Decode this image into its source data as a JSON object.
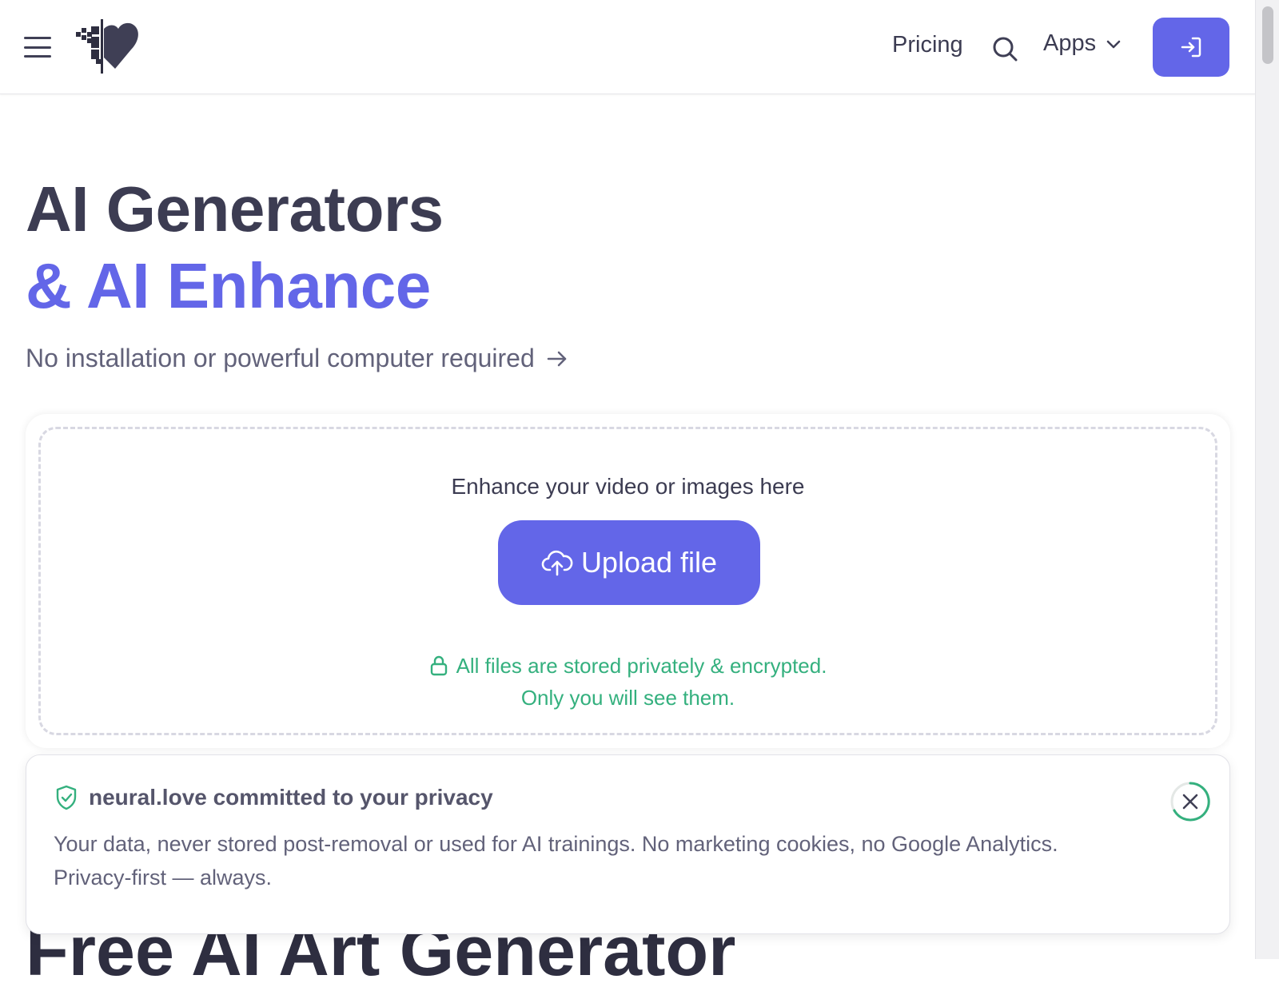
{
  "header": {
    "menu_icon": "hamburger-menu-icon",
    "logo_icon": "pixel-heart-logo",
    "nav": {
      "pricing_label": "Pricing",
      "search_icon": "search-icon",
      "apps_label": "Apps",
      "apps_icon": "chevron-down-icon"
    },
    "signin_icon": "sign-in-icon"
  },
  "hero": {
    "title_line1": "AI Generators",
    "title_line2": "& AI Enhance",
    "subtitle": "No installation or powerful computer required",
    "subtitle_icon": "arrow-right-icon"
  },
  "upload": {
    "title": "Enhance your video or images here",
    "button_label": "Upload file",
    "button_icon": "cloud-upload-icon",
    "privacy_line1": "All files are stored privately & encrypted.",
    "privacy_line2": "Only you will see them.",
    "privacy_icon": "lock-icon"
  },
  "next_section": {
    "heading": "Free AI Art Generator"
  },
  "toast": {
    "icon": "shield-check-icon",
    "title": "neural.love committed to your privacy",
    "body": "Your data, never stored post-removal or used for AI trainings. No marketing cookies, no Google Analytics. Privacy-first — always.",
    "close_icon": "close-icon"
  },
  "colors": {
    "accent": "#6366e8",
    "text_dark": "#3c3c52",
    "text_muted": "#62627a",
    "success_green": "#34b07e",
    "border": "#d8d8e2"
  }
}
